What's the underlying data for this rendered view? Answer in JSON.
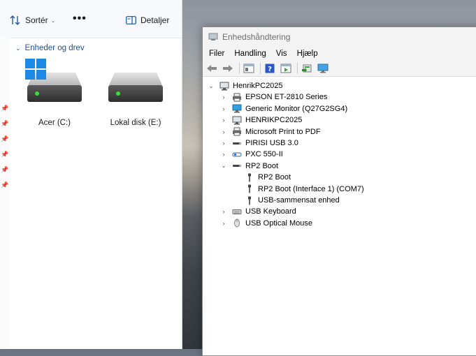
{
  "explorer": {
    "toolbar": {
      "sort_label": "Sortér",
      "more_label": "•••",
      "details_label": "Detaljer"
    },
    "group_label": "Enheder og drev",
    "drives": [
      {
        "label": "Acer (C:)",
        "icon": "windows-drive-icon"
      },
      {
        "label": "Lokal disk (E:)",
        "icon": "hard-drive-icon"
      }
    ]
  },
  "device_manager": {
    "title": "Enhedshåndtering",
    "menu": [
      "Filer",
      "Handling",
      "Vis",
      "Hjælp"
    ],
    "tree": {
      "root": "HenrikPC2025",
      "items": [
        {
          "label": "EPSON ET-2810 Series",
          "icon": "printer-icon",
          "expanded": false
        },
        {
          "label": "Generic Monitor (Q27G2SG4)",
          "icon": "monitor-icon",
          "expanded": false
        },
        {
          "label": "HENRIKPC2025",
          "icon": "computer-icon",
          "expanded": false
        },
        {
          "label": "Microsoft Print to PDF",
          "icon": "printer-icon",
          "expanded": false
        },
        {
          "label": "PIRISI USB 3.0",
          "icon": "usb-device-icon",
          "expanded": false
        },
        {
          "label": "PXC 550-II",
          "icon": "bluetooth-device-icon",
          "expanded": false
        },
        {
          "label": "RP2 Boot",
          "icon": "usb-device-icon",
          "expanded": true,
          "children": [
            {
              "label": "RP2 Boot",
              "icon": "usb-plug-icon"
            },
            {
              "label": "RP2 Boot (Interface 1) (COM7)",
              "icon": "usb-plug-icon"
            },
            {
              "label": "USB-sammensat enhed",
              "icon": "usb-plug-icon"
            }
          ]
        },
        {
          "label": "USB Keyboard",
          "icon": "keyboard-icon",
          "expanded": false
        },
        {
          "label": "USB Optical Mouse",
          "icon": "mouse-icon",
          "expanded": false
        }
      ]
    }
  }
}
